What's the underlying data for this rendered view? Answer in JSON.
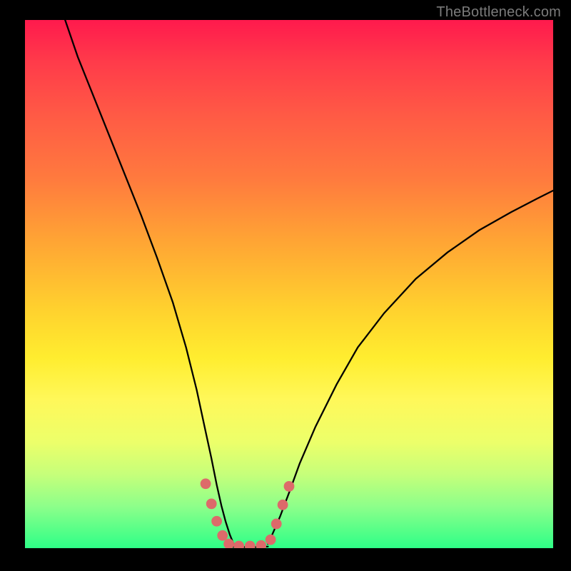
{
  "watermark": "TheBottleneck.com",
  "colors": {
    "background": "#000000",
    "gradient_top": "#ff1a4d",
    "gradient_mid": "#ffd22e",
    "gradient_bottom": "#2eff87",
    "curve": "#000000",
    "marker": "#dd6a6a"
  },
  "chart_data": {
    "type": "line",
    "title": "",
    "xlabel": "",
    "ylabel": "",
    "x_range": [
      0,
      100
    ],
    "y_range": [
      0,
      100
    ],
    "note": "Two black curves forming a V shape with minimum near the bottom center; short salmon segments mark the curve near the valley. Values are percentages of the plot area width/height, estimated from pixels.",
    "series": [
      {
        "name": "left-curve",
        "x": [
          7.6,
          10,
          13,
          16,
          19,
          22,
          25,
          28,
          30.5,
          32.5,
          34,
          35.3,
          36.3,
          37.2,
          38,
          38.8,
          39.5
        ],
        "y": [
          100,
          93,
          85.5,
          78,
          70.5,
          63,
          55,
          46.5,
          38,
          30,
          23,
          17,
          12,
          8,
          5,
          2.5,
          0.8
        ]
      },
      {
        "name": "right-curve",
        "x": [
          46,
          47,
          48.3,
          50,
          52,
          55,
          59,
          63,
          68,
          74,
          80,
          86,
          92,
          97,
          100
        ],
        "y": [
          0.8,
          3,
          6,
          10.5,
          16,
          23,
          31,
          38,
          44.5,
          51,
          56,
          60.2,
          63.6,
          66.2,
          67.7
        ]
      },
      {
        "name": "valley-floor",
        "x": [
          38,
          40,
          42,
          44,
          46
        ],
        "y": [
          0.3,
          0.2,
          0.2,
          0.2,
          0.3
        ]
      }
    ],
    "markers": {
      "name": "salmon-markers",
      "radius_pct": 1.0,
      "points": [
        {
          "x": 34.2,
          "y": 12.2
        },
        {
          "x": 35.3,
          "y": 8.4
        },
        {
          "x": 36.3,
          "y": 5.1
        },
        {
          "x": 37.4,
          "y": 2.4
        },
        {
          "x": 38.6,
          "y": 0.8
        },
        {
          "x": 40.5,
          "y": 0.4
        },
        {
          "x": 42.6,
          "y": 0.4
        },
        {
          "x": 44.7,
          "y": 0.5
        },
        {
          "x": 46.5,
          "y": 1.6
        },
        {
          "x": 47.6,
          "y": 4.6
        },
        {
          "x": 48.8,
          "y": 8.2
        },
        {
          "x": 50.0,
          "y": 11.7
        }
      ]
    }
  }
}
